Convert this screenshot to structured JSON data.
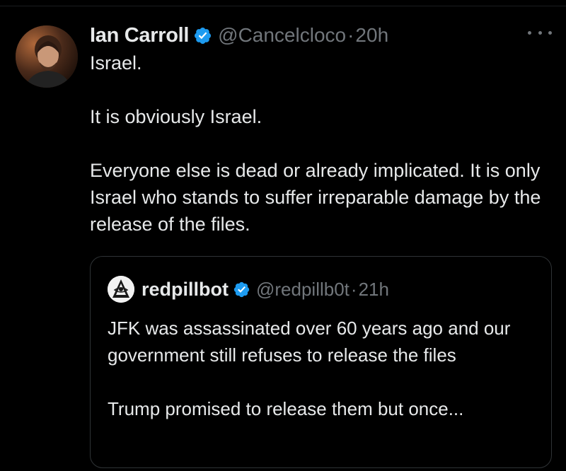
{
  "tweet": {
    "author_name": "Ian Carroll",
    "handle": "@Cancelcloco",
    "separator": "·",
    "time": "20h",
    "paragraphs": [
      "Israel.",
      "It is obviously Israel.",
      "Everyone else is dead or already implicated. It is only Israel who stands to suffer irreparable damage by the release of the files."
    ]
  },
  "quoted_tweet": {
    "author_name": "redpillbot",
    "handle": "@redpillb0t",
    "separator": "·",
    "time": "21h",
    "paragraphs": [
      "JFK was assassinated over 60 years ago and our government still refuses to release the files",
      "Trump promised to release them but once..."
    ]
  },
  "colors": {
    "background": "#000000",
    "primary_text": "#e7e9ea",
    "secondary_text": "#71767b",
    "verified_blue": "#1d9bf0",
    "border": "#2f3336"
  },
  "icons": {
    "verified": "verified-badge-icon",
    "more": "more-options-icon"
  }
}
